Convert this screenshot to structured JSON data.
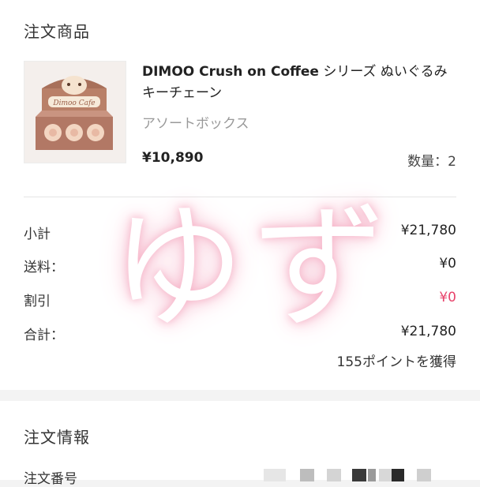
{
  "items_section": {
    "title": "注文商品",
    "product": {
      "name_latin": "DIMOO Crush on Coffee",
      "name_jp": " シリーズ ぬいぐるみキーチェーン",
      "variant": "アソートボックス",
      "price": "¥10,890",
      "quantity": "数量：2",
      "thumbnail_label": "Dimoo Cafe"
    }
  },
  "summary": {
    "subtotal_label": "小計",
    "subtotal_value": "¥21,780",
    "shipping_label": "送料：",
    "shipping_value": "¥0",
    "discount_label": "割引",
    "discount_value": "¥0",
    "total_label": "合計：",
    "total_value": "¥21,780",
    "points": "155ポイントを獲得"
  },
  "watermark": "ゆず",
  "order_info": {
    "title": "注文情報",
    "order_number_label": "注文番号"
  },
  "colors": {
    "discount_red": "#e8436b",
    "background": "#f3f3f3"
  }
}
